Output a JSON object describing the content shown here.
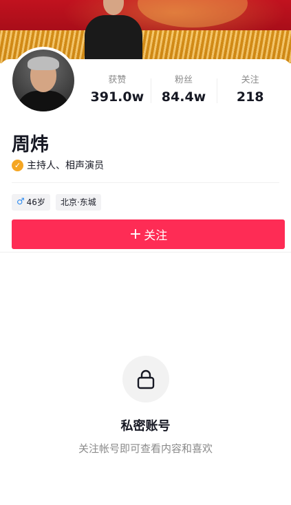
{
  "profile": {
    "name": "周炜",
    "verification": "主持人、相声演员",
    "stats": [
      {
        "label": "获赞",
        "value": "391.0w"
      },
      {
        "label": "粉丝",
        "value": "84.4w"
      },
      {
        "label": "关注",
        "value": "218"
      }
    ],
    "tags": {
      "age": "46岁",
      "location": "北京·东城"
    },
    "follow_button": {
      "icon": "+",
      "label": "关注"
    }
  },
  "private_notice": {
    "title": "私密账号",
    "subtitle": "关注帐号即可查看内容和喜欢"
  },
  "colors": {
    "accent": "#fe2c55",
    "verify_badge": "#f5a623",
    "male_icon": "#2f8cf0"
  },
  "icons": [
    "verified-icon",
    "male-icon",
    "plus-icon",
    "lock-icon"
  ]
}
